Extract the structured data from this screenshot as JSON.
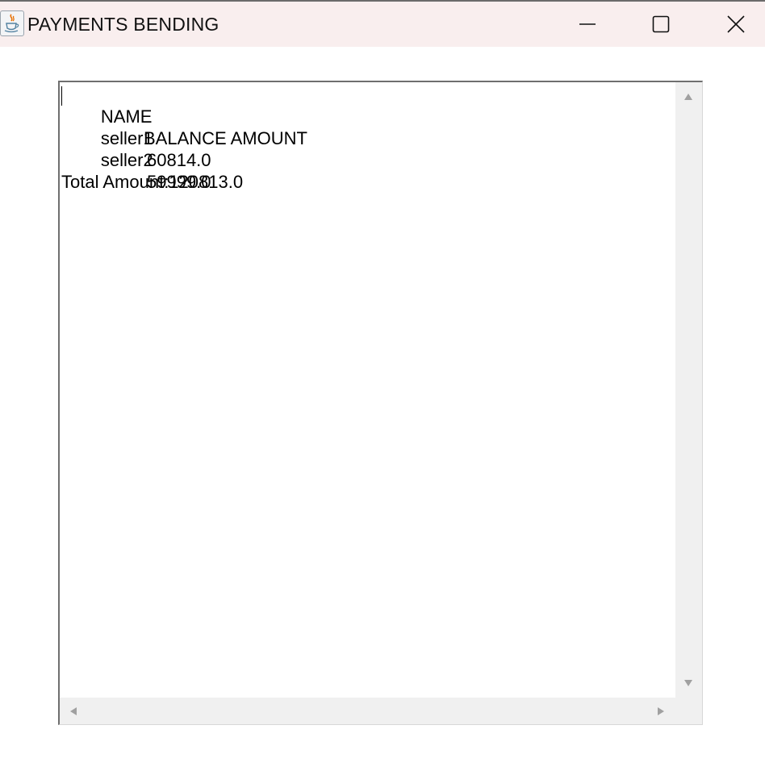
{
  "window": {
    "title": "PAYMENTS BENDING",
    "app_icon": "java-cup-icon",
    "controls": {
      "minimize_icon": "minimize-icon",
      "maximize_icon": "maximize-icon",
      "close_icon": "close-icon"
    }
  },
  "report": {
    "header": {
      "name": "NAME",
      "balance": "BALANCE AMOUNT"
    },
    "rows": [
      {
        "name": "seller1",
        "balance": "60814.0"
      },
      {
        "name": "seller2",
        "balance": "59999.0"
      }
    ],
    "total": "Total Amount:120813.0"
  },
  "scrollbars": {
    "up_icon": "scroll-up-arrow-icon",
    "down_icon": "scroll-down-arrow-icon",
    "left_icon": "scroll-left-arrow-icon",
    "right_icon": "scroll-right-arrow-icon"
  },
  "colors": {
    "titlebar": "#f9eeee",
    "scroll_track": "#f0f0f0",
    "arrow": "#a0a0a0"
  }
}
